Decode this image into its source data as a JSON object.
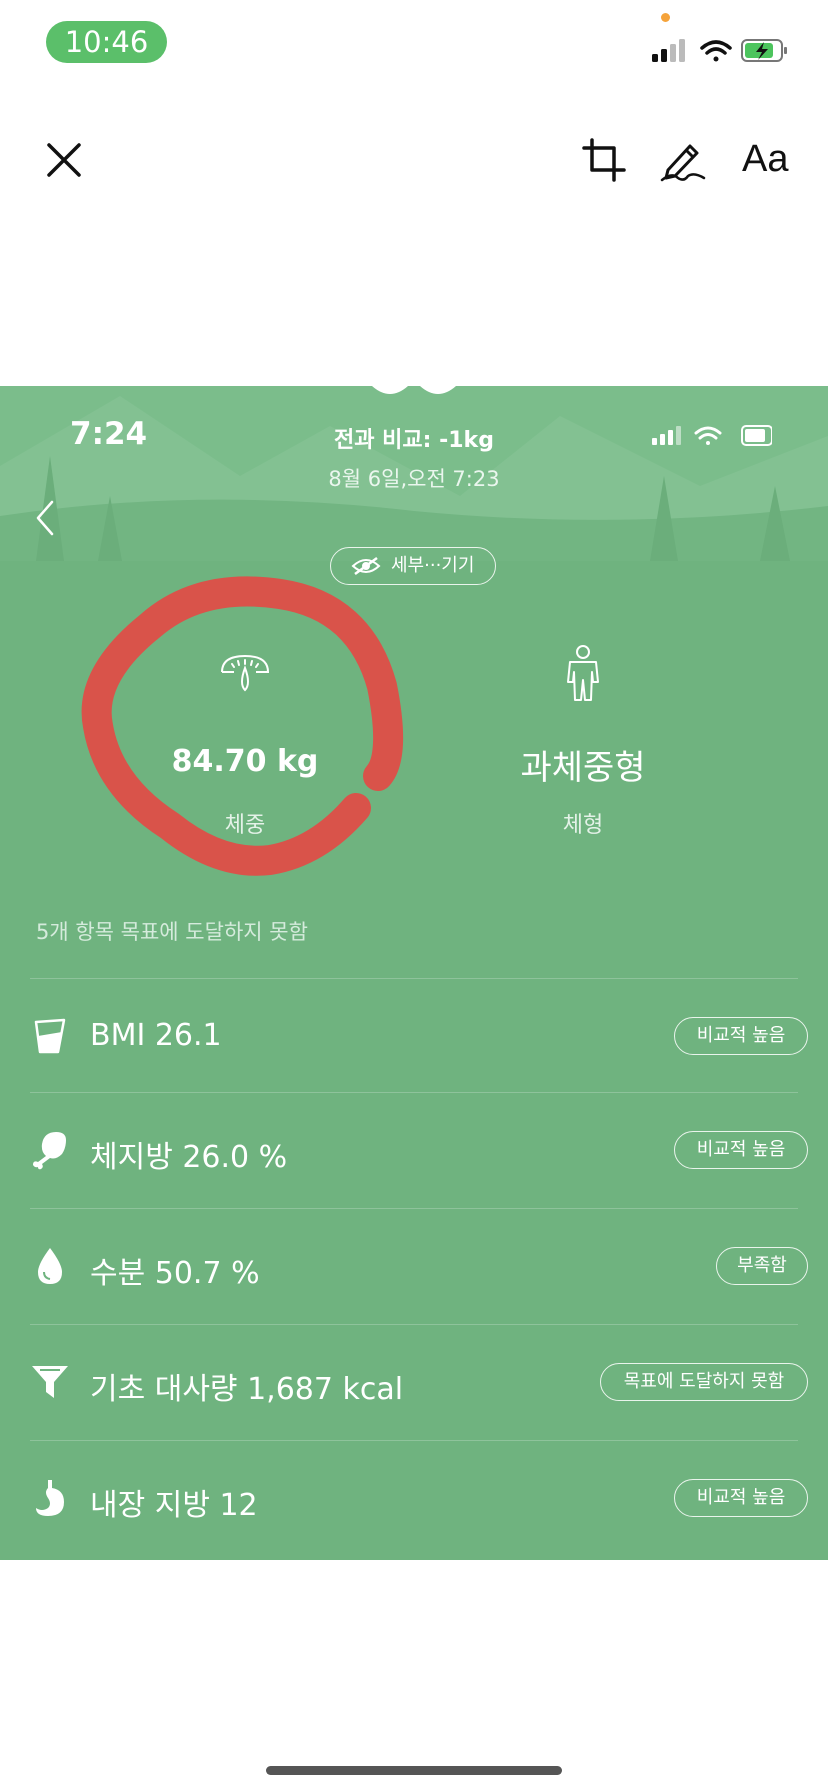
{
  "status_bar": {
    "time": "10:46"
  },
  "toolbar": {
    "close_icon": "close-icon",
    "crop_icon": "crop-icon",
    "markup_icon": "markup-pen-icon",
    "text_label": "Aa"
  },
  "screenshot": {
    "status": {
      "time": "7:24"
    },
    "header": {
      "compare": "전과 비교: -1kg",
      "datetime": "8월 6일,오전 7:23"
    },
    "detail_toggle": "세부···기기",
    "weight": {
      "value": "84.70 kg",
      "label": "체중"
    },
    "body_type": {
      "value": "과체중형",
      "label": "체형"
    },
    "notice": "5개 항목 목표에 도달하지 못함",
    "metrics": [
      {
        "icon": "bmi-cup-icon",
        "text": "BMI 26.1",
        "badge": "비교적 높음"
      },
      {
        "icon": "drumstick-icon",
        "text": "체지방 26.0 %",
        "badge": "비교적 높음"
      },
      {
        "icon": "water-drop-icon",
        "text": "수분 50.7 %",
        "badge": "부족함"
      },
      {
        "icon": "funnel-icon",
        "text": "기초 대사량 1,687 kcal",
        "badge": "목표에 도달하지 못함"
      },
      {
        "icon": "stomach-icon",
        "text": "내장 지방 12",
        "badge": "비교적 높음"
      }
    ]
  },
  "colors": {
    "background_green": "#6fb37f",
    "annotation_red": "#d9534a",
    "pill_green": "#5bbf6a"
  }
}
